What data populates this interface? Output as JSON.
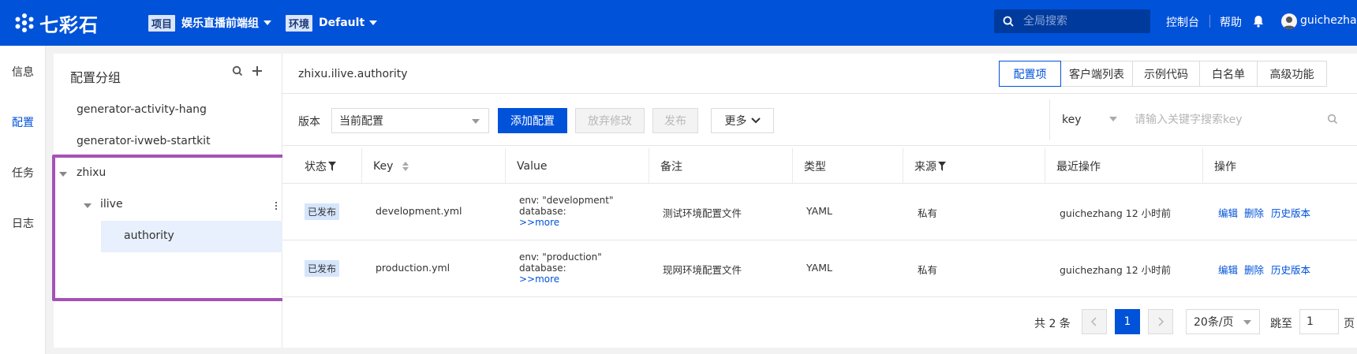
{
  "header": {
    "brand": "七彩石",
    "project_tag": "项目",
    "project_value": "娱乐直播前端组",
    "env_tag": "环境",
    "env_value": "Default",
    "search_placeholder": "全局搜索",
    "console_link": "控制台",
    "help_link": "帮助",
    "username": "guichezhang"
  },
  "leftnav": {
    "items": [
      {
        "label": "信息",
        "active": false
      },
      {
        "label": "配置",
        "active": true
      },
      {
        "label": "任务",
        "active": false
      },
      {
        "label": "日志",
        "active": false
      }
    ]
  },
  "groups": {
    "title": "配置分组",
    "items": [
      {
        "label": "generator-activity-hang"
      },
      {
        "label": "generator-ivweb-startkit"
      },
      {
        "label": "zhixu"
      },
      {
        "label": "ilive"
      },
      {
        "label": "authority"
      }
    ]
  },
  "main": {
    "path": "zhixu.ilive.authority",
    "tabs": [
      {
        "label": "配置项",
        "active": true
      },
      {
        "label": "客户端列表",
        "active": false
      },
      {
        "label": "示例代码",
        "active": false
      },
      {
        "label": "白名单",
        "active": false
      },
      {
        "label": "高级功能",
        "active": false
      }
    ],
    "toolbar": {
      "version_label": "版本",
      "version_value": "当前配置",
      "add_label": "添加配置",
      "discard_label": "放弃修改",
      "publish_label": "发布",
      "more_label": "更多",
      "search_field": "key",
      "search_placeholder": "请输入关键字搜索key"
    },
    "table": {
      "columns": [
        "状态",
        "Key",
        "Value",
        "备注",
        "类型",
        "来源",
        "最近操作",
        "操作"
      ],
      "rows": [
        {
          "status": "已发布",
          "key": "development.yml",
          "value_line1": "env: \"development\"",
          "value_line2": "database:",
          "value_more": ">>more",
          "note": "测试环境配置文件",
          "type": "YAML",
          "source": "私有",
          "last_op": "guichezhang 12 小时前",
          "op_edit": "编辑",
          "op_delete": "删除",
          "op_history": "历史版本"
        },
        {
          "status": "已发布",
          "key": "production.yml",
          "value_line1": "env: \"production\"",
          "value_line2": "database:",
          "value_more": ">>more",
          "note": "现网环境配置文件",
          "type": "YAML",
          "source": "私有",
          "last_op": "guichezhang 12 小时前",
          "op_edit": "编辑",
          "op_delete": "删除",
          "op_history": "历史版本"
        }
      ]
    },
    "pagination": {
      "total_text": "共 2 条",
      "current_page": "1",
      "page_size": "20条/页",
      "jump_label": "跳至",
      "jump_value": "1",
      "page_suffix": "页"
    }
  },
  "colors": {
    "brand_blue": "#0052d9",
    "highlight_purple": "#a552b6",
    "badge_bg": "#d5e5fb"
  }
}
